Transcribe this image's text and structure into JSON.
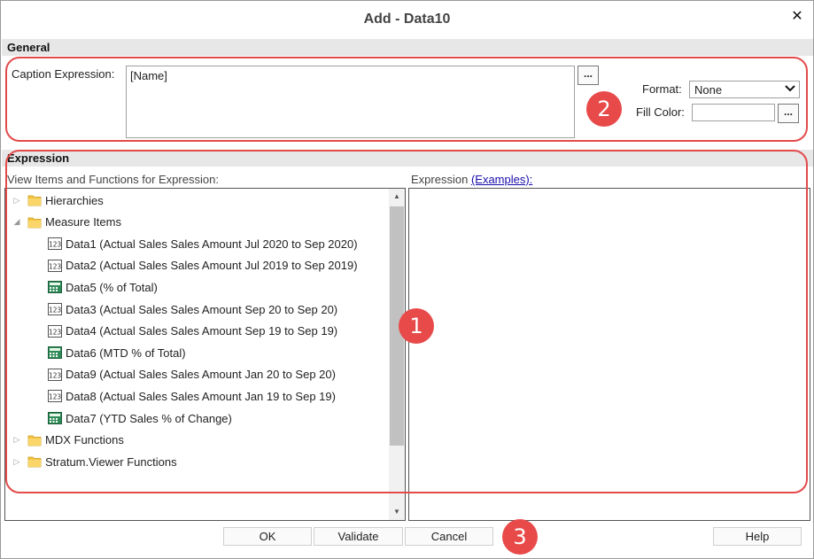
{
  "dialog": {
    "title": "Add - Data10",
    "close_glyph": "✕"
  },
  "general": {
    "header": "General",
    "caption_label": "Caption Expression:",
    "caption_value": "[Name]",
    "caption_button": "...",
    "format_label": "Format:",
    "format_value": "None",
    "fill_color_label": "Fill Color:",
    "fill_color_value": "",
    "fill_color_button": "..."
  },
  "expression": {
    "header": "Expression",
    "items_label": "View Items and Functions for Expression:",
    "expr_label": "Expression",
    "examples_link": "(Examples):",
    "tree": [
      {
        "label": "Hierarchies",
        "type": "folder",
        "level": 0,
        "expanded": false
      },
      {
        "label": "Measure Items",
        "type": "folder",
        "level": 0,
        "expanded": true
      },
      {
        "label": "Data1 (Actual Sales Sales Amount Jul 2020 to Sep 2020)",
        "type": "measure",
        "icon": "numeric-measure-icon",
        "level": 1
      },
      {
        "label": "Data2 (Actual Sales Sales Amount Jul 2019 to Sep 2019)",
        "type": "measure",
        "icon": "numeric-measure-icon",
        "level": 1
      },
      {
        "label": "Data5 (% of Total)",
        "type": "calc",
        "icon": "calculator-icon",
        "level": 1
      },
      {
        "label": "Data3 (Actual Sales Sales Amount Sep 20 to Sep 20)",
        "type": "measure",
        "icon": "numeric-measure-icon",
        "level": 1
      },
      {
        "label": "Data4 (Actual Sales Sales Amount Sep 19 to Sep 19)",
        "type": "measure",
        "icon": "numeric-measure-icon",
        "level": 1
      },
      {
        "label": "Data6 (MTD % of Total)",
        "type": "calc",
        "icon": "calculator-icon",
        "level": 1
      },
      {
        "label": "Data9 (Actual Sales Sales Amount Jan 20 to Sep 20)",
        "type": "measure",
        "icon": "numeric-measure-icon",
        "level": 1
      },
      {
        "label": "Data8 (Actual Sales Sales Amount Jan 19 to Sep 19)",
        "type": "measure",
        "icon": "numeric-measure-icon",
        "level": 1
      },
      {
        "label": "Data7 (YTD Sales % of Change)",
        "type": "calc",
        "icon": "calculator-icon",
        "level": 1
      },
      {
        "label": "MDX Functions",
        "type": "folder",
        "level": 0,
        "expanded": false
      },
      {
        "label": "Stratum.Viewer Functions",
        "type": "folder",
        "level": 0,
        "expanded": false
      }
    ]
  },
  "footer": {
    "ok": "OK",
    "validate": "Validate",
    "cancel": "Cancel",
    "help": "Help"
  },
  "callouts": {
    "one": "1",
    "two": "2",
    "three": "3",
    "color": "#e84a4a"
  }
}
